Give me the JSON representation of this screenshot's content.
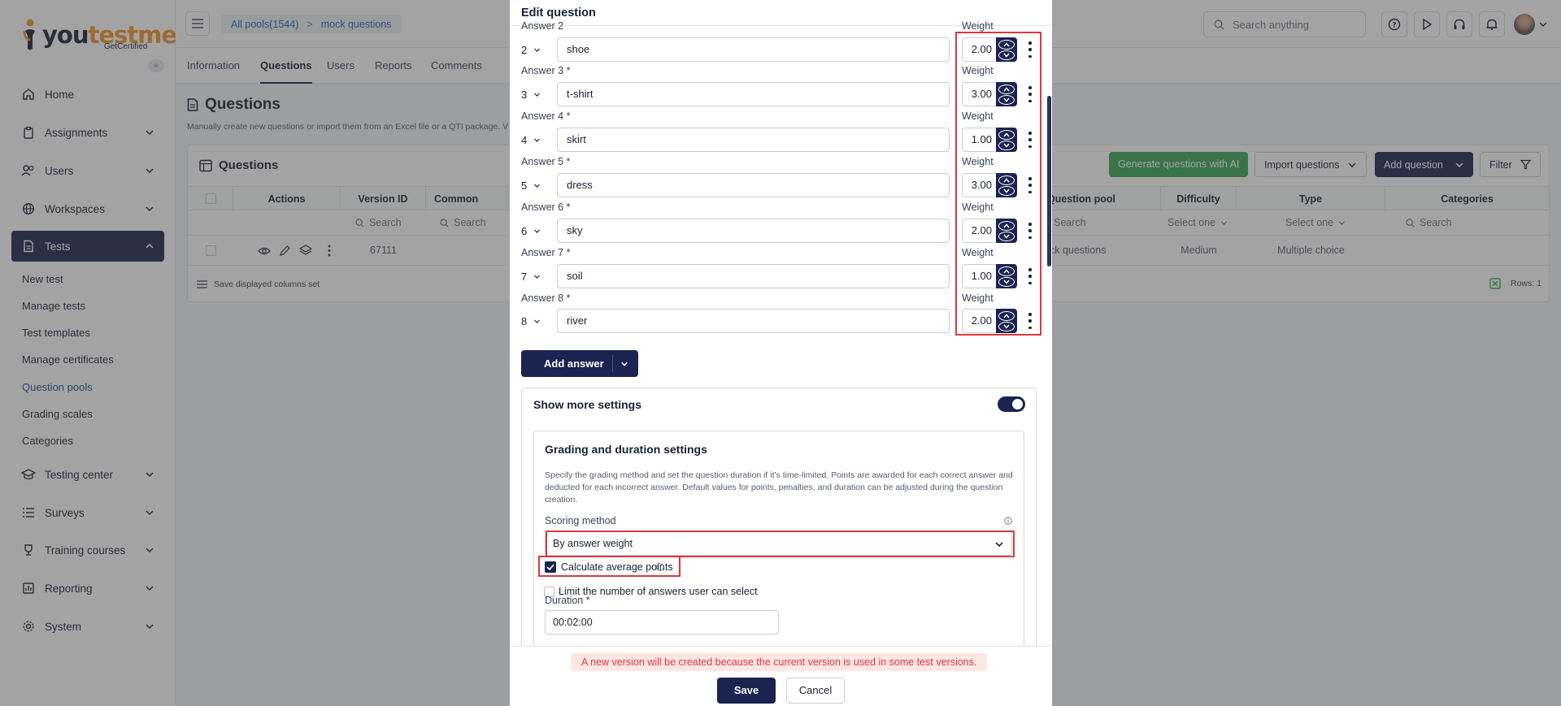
{
  "logo": {
    "text_a": "you",
    "text_b": "testme",
    "sub": "GetCertified"
  },
  "sidebar": {
    "items": [
      {
        "label": "Home",
        "icon": "home-icon"
      },
      {
        "label": "Assignments",
        "icon": "clipboard-icon"
      },
      {
        "label": "Users",
        "icon": "users-icon"
      },
      {
        "label": "Workspaces",
        "icon": "globe-icon"
      },
      {
        "label": "Tests",
        "icon": "document-icon"
      },
      {
        "label": "Testing center",
        "icon": "graduation-cap-icon"
      },
      {
        "label": "Surveys",
        "icon": "list-icon"
      },
      {
        "label": "Training courses",
        "icon": "trophy-icon"
      },
      {
        "label": "Reporting",
        "icon": "report-icon"
      },
      {
        "label": "System",
        "icon": "gear-icon"
      }
    ],
    "sub_items": [
      "New test",
      "Manage tests",
      "Test templates",
      "Manage certificates",
      "Question pools",
      "Grading scales",
      "Categories"
    ]
  },
  "topbar": {
    "breadcrumb": [
      "All pools(1544)",
      ">",
      "mock questions"
    ],
    "search_placeholder": "Search anything"
  },
  "tabs": [
    "Information",
    "Questions",
    "Users",
    "Reports",
    "Comments"
  ],
  "page": {
    "title": "Questions",
    "description": "Manually create new questions or import them from an Excel file or a QTI package. V"
  },
  "card": {
    "title": "Questions",
    "btn_generate": "Generate questions with AI",
    "btn_import": "Import questions",
    "btn_add": "Add question",
    "btn_filter": "Filter"
  },
  "table": {
    "headers": [
      "Actions",
      "Version ID",
      "Common externa",
      "Question pool",
      "Difficulty",
      "Type",
      "Categories"
    ],
    "filter_search": "Search",
    "filter_select": "Select one",
    "row": {
      "version_id": "67111",
      "pool": "ck questions",
      "difficulty": "Medium",
      "type": "Multiple choice"
    },
    "footer_label": "Save displayed columns set",
    "rows_label": "Rows: 1"
  },
  "modal": {
    "title": "Edit question",
    "weight_label": "Weight",
    "answers": [
      {
        "label": "Answer 2",
        "num": "2",
        "value": "shoe",
        "weight": "2.00"
      },
      {
        "label": "Answer 3 *",
        "num": "3",
        "value": "t-shirt",
        "weight": "3.00"
      },
      {
        "label": "Answer 4 *",
        "num": "4",
        "value": "skirt",
        "weight": "1.00"
      },
      {
        "label": "Answer 5 *",
        "num": "5",
        "value": "dress",
        "weight": "3.00"
      },
      {
        "label": "Answer 6 *",
        "num": "6",
        "value": "sky",
        "weight": "2.00"
      },
      {
        "label": "Answer 7 *",
        "num": "7",
        "value": "soil",
        "weight": "1.00"
      },
      {
        "label": "Answer 8 *",
        "num": "8",
        "value": "river",
        "weight": "2.00"
      }
    ],
    "add_answer": "Add answer",
    "show_more": "Show more settings",
    "grading_title": "Grading and duration settings",
    "grading_desc": "Specify the grading method and set the question duration if it's time-limited. Points are awarded for each correct answer and deducted for each incorrect answer. Default values for points, penalties, and duration can be adjusted during the question creation.",
    "scoring_label": "Scoring method",
    "scoring_value": "By answer weight",
    "avg_points": "Calculate average points",
    "limit_answers": "Limit the number of answers user can select",
    "duration_label": "Duration",
    "duration_required": "*",
    "duration_value": "00:02:00",
    "warning": "A new version will be created because the current version is used in some test versions.",
    "save": "Save",
    "cancel": "Cancel"
  },
  "colors": {
    "navy": "#1b2450",
    "green": "#3aa655",
    "red": "#d93a3a",
    "orange": "#f2962b"
  }
}
